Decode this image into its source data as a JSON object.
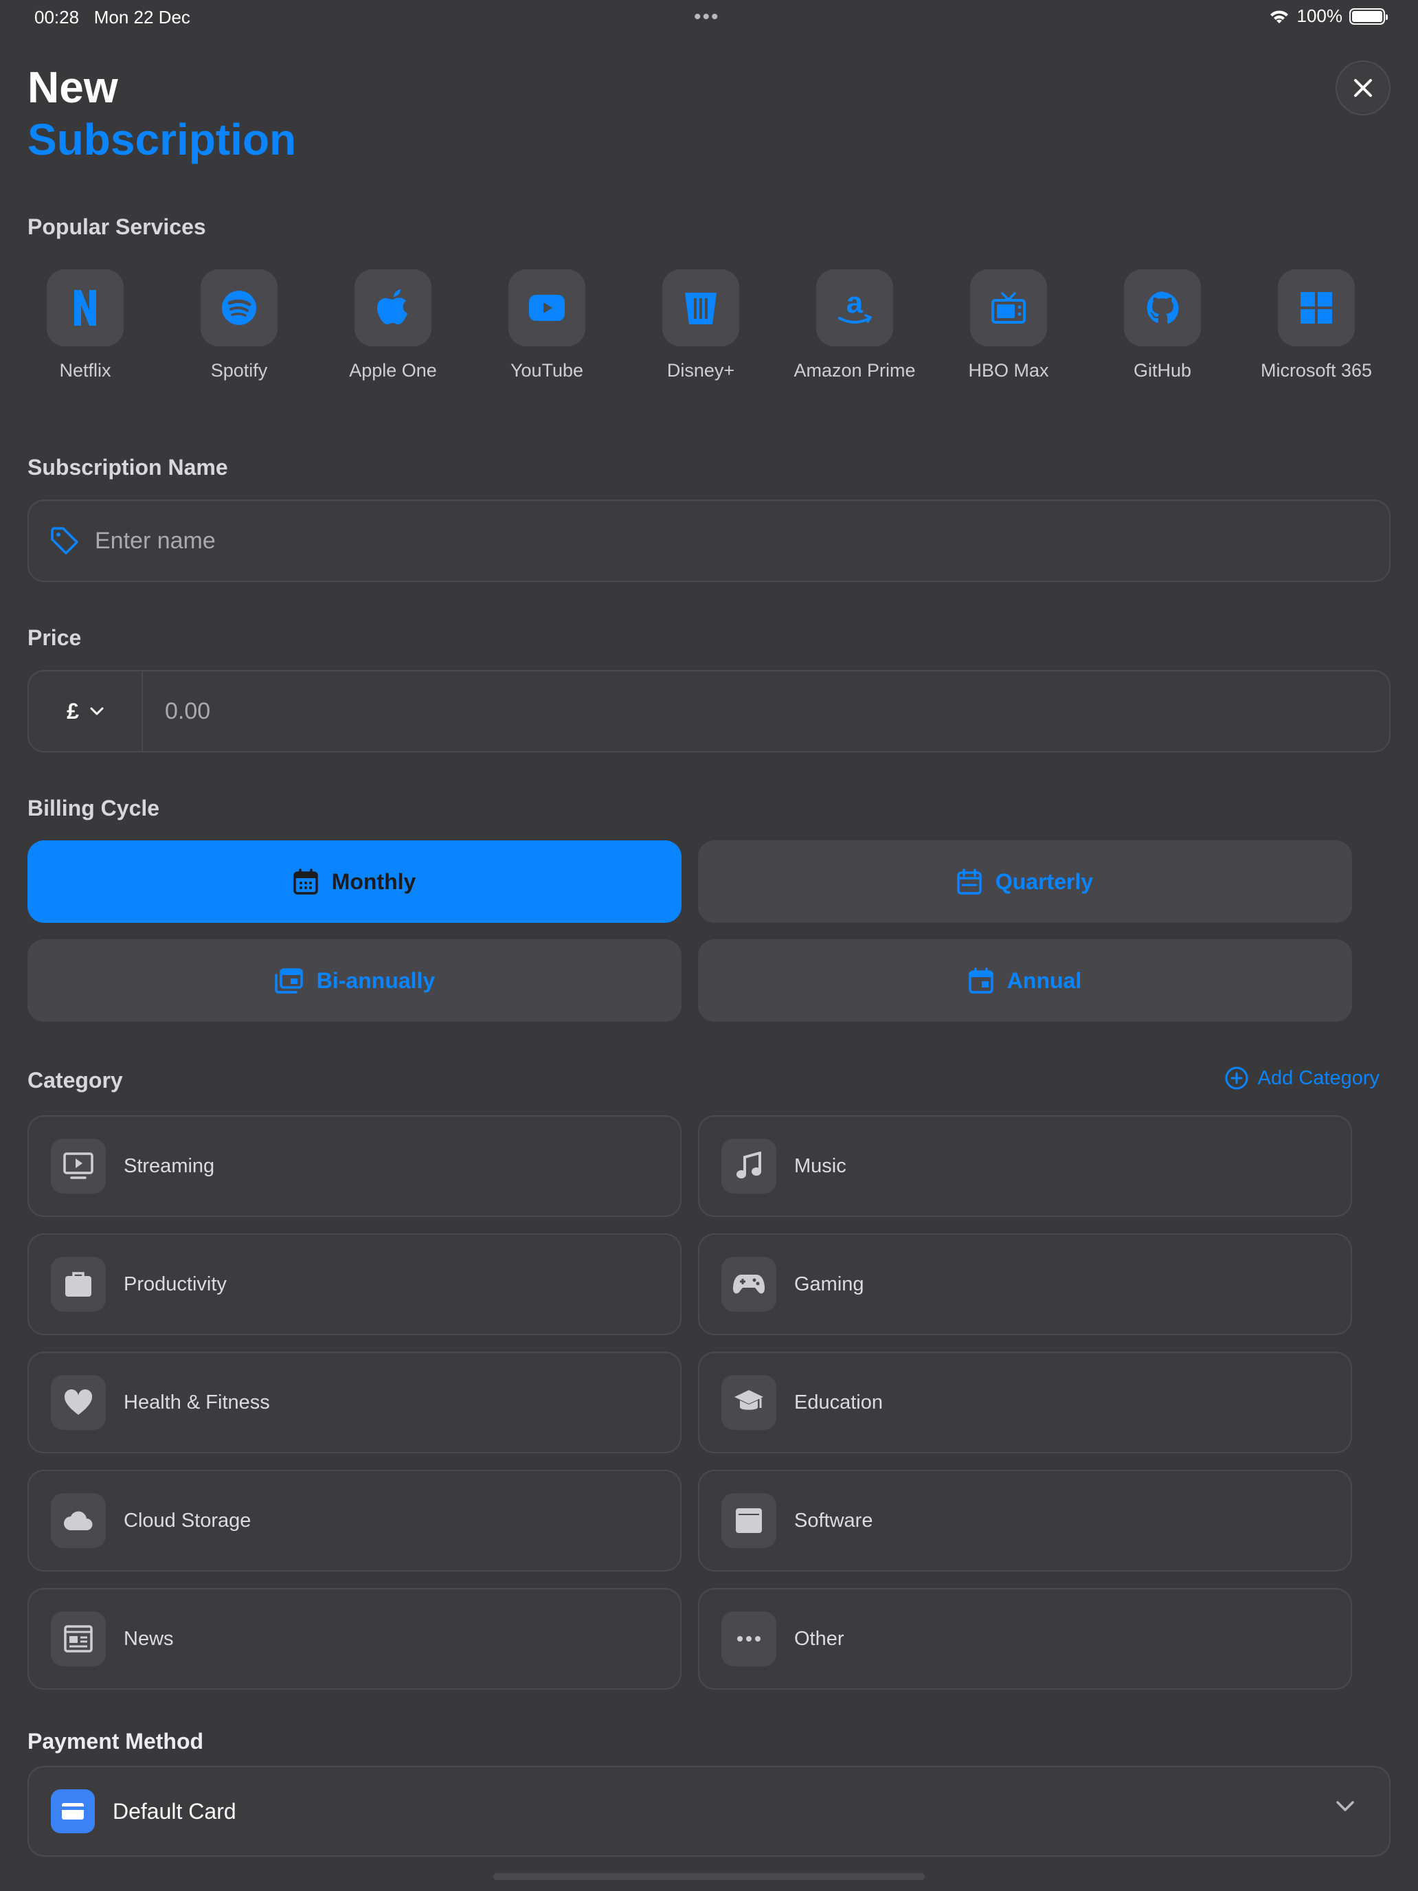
{
  "status_bar": {
    "time": "00:28",
    "date": "Mon 22 Dec",
    "battery": "100%"
  },
  "header": {
    "title_line1": "New",
    "title_line2": "Subscription",
    "close_icon": "close-icon"
  },
  "popular_services": {
    "label": "Popular Services",
    "items": [
      {
        "name": "Netflix",
        "icon": "netflix-icon"
      },
      {
        "name": "Spotify",
        "icon": "spotify-icon"
      },
      {
        "name": "Apple One",
        "icon": "apple-icon"
      },
      {
        "name": "YouTube",
        "icon": "youtube-icon"
      },
      {
        "name": "Disney+",
        "icon": "disney-icon"
      },
      {
        "name": "Amazon Prime",
        "icon": "amazon-icon"
      },
      {
        "name": "HBO Max",
        "icon": "tv-icon"
      },
      {
        "name": "GitHub",
        "icon": "github-icon"
      },
      {
        "name": "Microsoft 365",
        "icon": "microsoft-icon"
      }
    ]
  },
  "subscription_name": {
    "label": "Subscription Name",
    "placeholder": "Enter name",
    "value": ""
  },
  "price": {
    "label": "Price",
    "currency": "£",
    "placeholder": "0.00"
  },
  "billing_cycle": {
    "label": "Billing Cycle",
    "selected": "Monthly",
    "options": [
      "Monthly",
      "Quarterly",
      "Bi-annually",
      "Annual"
    ]
  },
  "category": {
    "label": "Category",
    "add_label": "Add Category",
    "items": [
      {
        "label": "Streaming",
        "icon": "play-screen-icon"
      },
      {
        "label": "Music",
        "icon": "music-note-icon"
      },
      {
        "label": "Productivity",
        "icon": "briefcase-icon"
      },
      {
        "label": "Gaming",
        "icon": "gamepad-icon"
      },
      {
        "label": "Health & Fitness",
        "icon": "heart-icon"
      },
      {
        "label": "Education",
        "icon": "graduation-cap-icon"
      },
      {
        "label": "Cloud Storage",
        "icon": "cloud-icon"
      },
      {
        "label": "Software",
        "icon": "window-icon"
      },
      {
        "label": "News",
        "icon": "newspaper-icon"
      },
      {
        "label": "Other",
        "icon": "ellipsis-icon"
      }
    ]
  },
  "payment_method": {
    "label": "Payment Method",
    "selected": "Default Card"
  },
  "colors": {
    "background": "#39393c",
    "accent": "#0a84ff",
    "tile": "#4a4a4e",
    "card": "#3b82f6"
  }
}
